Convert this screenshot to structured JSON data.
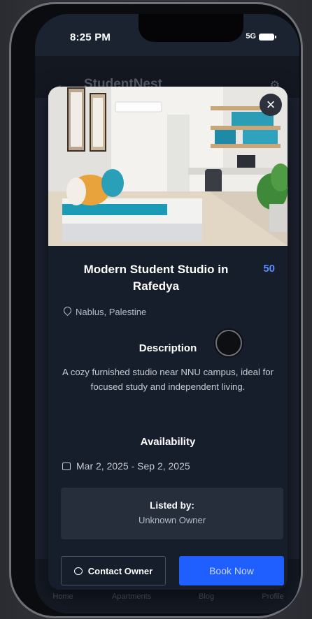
{
  "status_bar": {
    "time": "8:25 PM",
    "signal": "5G"
  },
  "background_app": {
    "title": "StudentNest",
    "nav": [
      "Home",
      "Apartments",
      "Blog",
      "Profile"
    ]
  },
  "listing": {
    "title": "Modern Student Studio in Rafedya",
    "price": "50",
    "location": "Nablus, Palestine",
    "description_heading": "Description",
    "description": "A cozy furnished studio near NNU campus, ideal for focused study and independent living.",
    "availability_heading": "Availability",
    "availability": "Mar 2, 2025 - Sep 2, 2025",
    "listed_by_label": "Listed by:",
    "owner": "Unknown Owner"
  },
  "actions": {
    "contact": "Contact Owner",
    "book": "Book Now"
  },
  "icons": {
    "close": "close-icon",
    "location": "location-pin-icon",
    "calendar": "calendar-icon",
    "chat": "chat-bubble-icon"
  },
  "colors": {
    "accent": "#1f5fff",
    "price": "#5b8cff",
    "modal_bg": "#161d2b"
  }
}
